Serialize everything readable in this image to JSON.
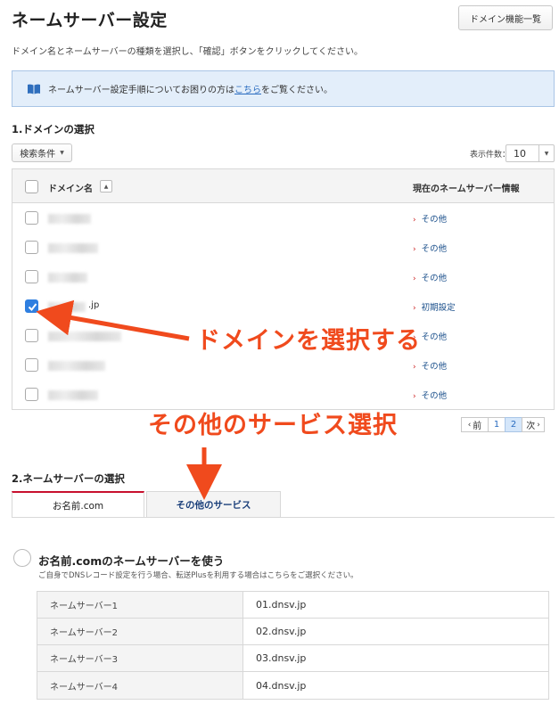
{
  "page": {
    "title": "ネームサーバー設定",
    "domain_list_button": "ドメイン機能一覧",
    "description": "ドメイン名とネームサーバーの種類を選択し、「確認」ボタンをクリックしてください。"
  },
  "info": {
    "icon": "book-icon",
    "text_before": "ネームサーバー設定手順についてお困りの方は",
    "link": "こちら",
    "text_after": "をご覧ください。"
  },
  "section1": {
    "heading": "1.ドメインの選択",
    "filter_button": "検索条件",
    "per_page_label": "表示件数：",
    "per_page_value": "10"
  },
  "domain_table": {
    "col_domain": "ドメイン名",
    "col_ns": "現在のネームサーバー情報",
    "rows": [
      {
        "domain_suffix": "",
        "ns": "その他",
        "checked": false
      },
      {
        "domain_suffix": "",
        "ns": "その他",
        "checked": false
      },
      {
        "domain_suffix": "",
        "ns": "その他",
        "checked": false
      },
      {
        "domain_suffix": ".jp",
        "ns": "初期設定",
        "checked": true
      },
      {
        "domain_suffix": "",
        "ns": "その他",
        "checked": false
      },
      {
        "domain_suffix": "",
        "ns": "その他",
        "checked": false
      },
      {
        "domain_suffix": "",
        "ns": "その他",
        "checked": false
      }
    ]
  },
  "pagination": {
    "prev": "前",
    "pages": [
      "1",
      "2"
    ],
    "current_page": "2",
    "next": "次"
  },
  "annotations": {
    "select_domain": "ドメインを選択する",
    "select_other": "その他のサービス選択",
    "color": "#f04a1d"
  },
  "section2": {
    "heading": "2.ネームサーバーの選択",
    "tabs": [
      "お名前.com",
      "その他のサービス"
    ],
    "active_tab": "お名前.com",
    "option_title": "お名前.comのネームサーバーを使う",
    "option_desc": "ご自身でDNSレコード設定を行う場合、転送Plusを利用する場合はこちらをご選択ください。",
    "nameservers": [
      {
        "label": "ネームサーバー1",
        "value": "01.dnsv.jp"
      },
      {
        "label": "ネームサーバー2",
        "value": "02.dnsv.jp"
      },
      {
        "label": "ネームサーバー3",
        "value": "03.dnsv.jp"
      },
      {
        "label": "ネームサーバー4",
        "value": "04.dnsv.jp"
      }
    ]
  },
  "colors": {
    "accent_red": "#c8102e",
    "link_blue": "#2a6cc0",
    "checkbox_blue": "#2f7fe0",
    "info_bg": "#e3eefa"
  }
}
